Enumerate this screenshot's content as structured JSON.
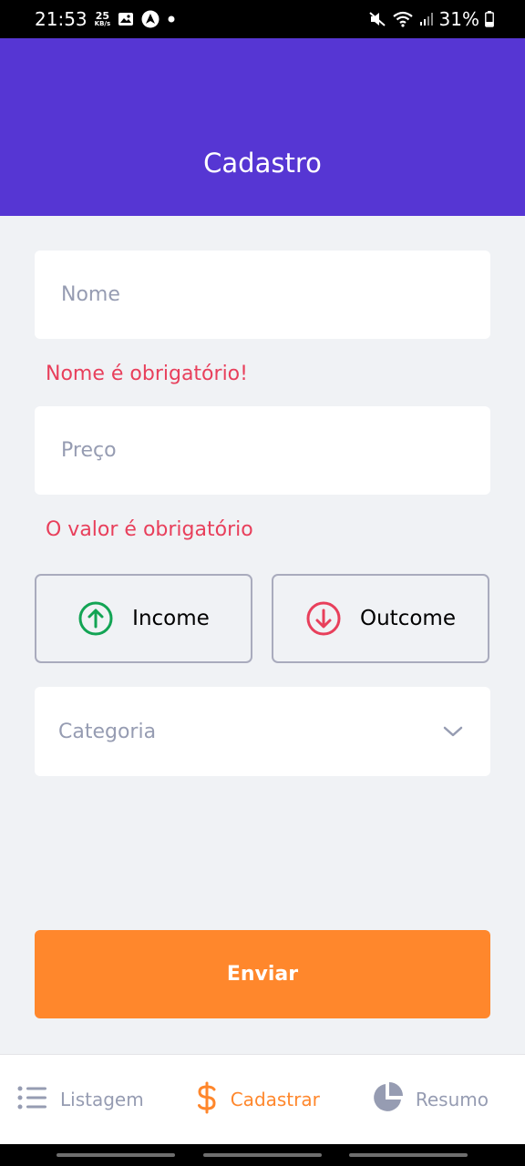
{
  "status_bar": {
    "time": "21:53",
    "net_speed_value": "25",
    "net_speed_unit": "KB/s",
    "battery": "31%"
  },
  "header": {
    "title": "Cadastro"
  },
  "form": {
    "name_placeholder": "Nome",
    "name_error": "Nome é obrigatório!",
    "price_placeholder": "Preço",
    "price_error": "O valor é obrigatório",
    "income_label": "Income",
    "outcome_label": "Outcome",
    "category_placeholder": "Categoria",
    "submit_label": "Enviar"
  },
  "bottom_nav": {
    "items": [
      {
        "label": "Listagem",
        "icon": "list-icon",
        "active": false
      },
      {
        "label": "Cadastrar",
        "icon": "dollar-icon",
        "active": true
      },
      {
        "label": "Resumo",
        "icon": "pie-chart-icon",
        "active": false
      }
    ]
  },
  "colors": {
    "primary": "#5636d3",
    "secondary": "#ff872c",
    "success": "#12a454",
    "attention": "#e83f5b",
    "text_muted": "#969cb2",
    "background": "#f0f2f5"
  }
}
